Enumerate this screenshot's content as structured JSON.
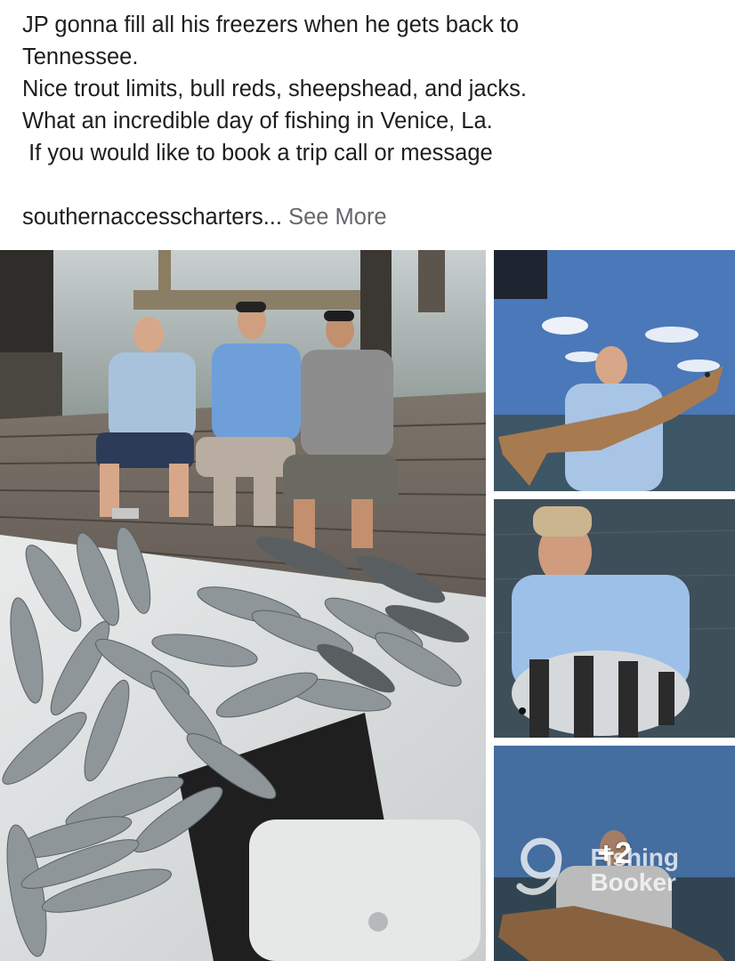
{
  "post": {
    "lines": [
      "JP gonna fill all his freezers when he gets back to",
      "Tennessee.",
      "Nice trout limits, bull reds, sheepshead, and jacks.",
      "What an incredible day of fishing in Venice, La.",
      " If you would like to book a trip call or message"
    ],
    "truncated_line": "southernaccesscharters...",
    "see_more_label": "See More"
  },
  "gallery": {
    "more_photos_label": "+2",
    "watermark": {
      "line1": "Fishing",
      "line2": "Booker"
    }
  },
  "colors": {
    "text": "#1c1e21",
    "secondary_text": "#65676b",
    "sky": "#4a78b8",
    "water": "#3d4f5c",
    "dock_wood": "#6b625a"
  }
}
